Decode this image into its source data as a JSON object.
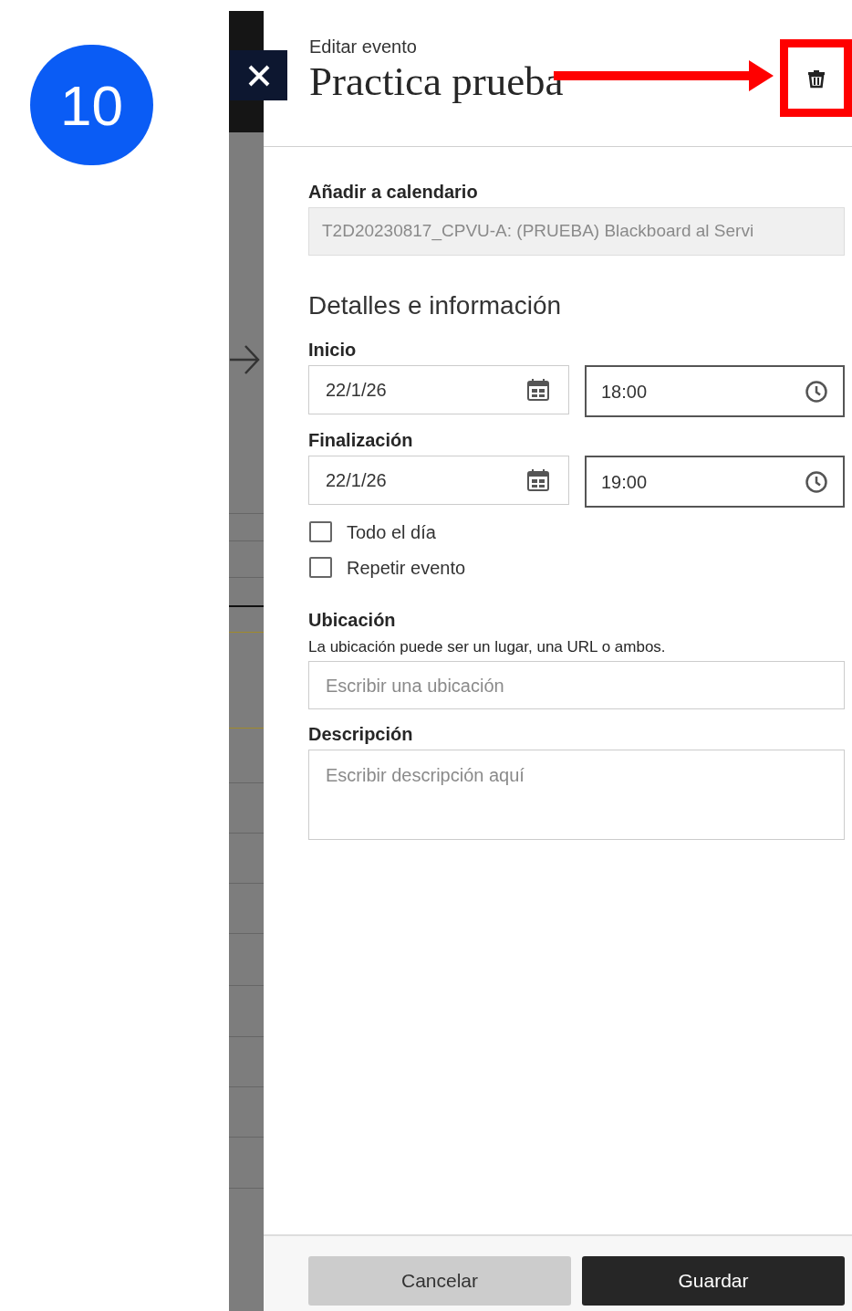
{
  "step_badge": "10",
  "header": {
    "subtitle": "Editar evento",
    "title": "Practica prueba"
  },
  "calendar": {
    "label": "Añadir a calendario",
    "value": "T2D20230817_CPVU-A: (PRUEBA) Blackboard al Servi",
    "disabled": true
  },
  "section_heading": "Detalles e información",
  "start": {
    "label": "Inicio",
    "date": "22/1/26",
    "time": "18:00"
  },
  "end": {
    "label": "Finalización",
    "date": "22/1/26",
    "time": "19:00"
  },
  "options": [
    {
      "label": "Todo el día",
      "checked": false
    },
    {
      "label": "Repetir evento",
      "checked": false
    }
  ],
  "location": {
    "label": "Ubicación",
    "hint": "La ubicación puede ser un lugar, una URL o ambos.",
    "placeholder": "Escribir una ubicación"
  },
  "description": {
    "label": "Descripción",
    "placeholder": "Escribir descripción aquí"
  },
  "buttons": [
    {
      "label": "Cancelar",
      "kind": "secondary"
    },
    {
      "label": "Guardar",
      "kind": "primary"
    }
  ]
}
